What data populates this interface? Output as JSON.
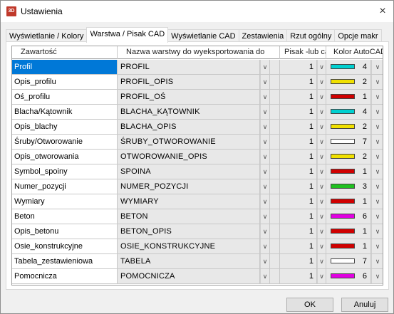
{
  "window": {
    "title": "Ustawienia",
    "app_icon_text": "3D",
    "close_glyph": "×"
  },
  "tabs": [
    {
      "label": "Wyświetlanie / Kolory",
      "active": false
    },
    {
      "label": "Warstwa / Pisak CAD",
      "active": true
    },
    {
      "label": "Wyświetlanie CAD",
      "active": false
    },
    {
      "label": "Zestawienia",
      "active": false
    },
    {
      "label": "Rzut ogólny",
      "active": false
    },
    {
      "label": "Opcje makr",
      "active": false
    }
  ],
  "grid": {
    "headers": {
      "content": "Zawartość",
      "layer": "Nazwa warstwy do wyeksportowania do",
      "pen": "Pisak -lub cad-",
      "color": "Kolor AutoCAD"
    },
    "dropdown_glyph": "∨",
    "rows": [
      {
        "content": "Profil",
        "layer": "PROFIL",
        "pen": "1",
        "color_num": "4",
        "color": "#00d0d0",
        "selected": true
      },
      {
        "content": "Opis_profilu",
        "layer": "PROFIL_OPIS",
        "pen": "1",
        "color_num": "2",
        "color": "#f0e000",
        "selected": false
      },
      {
        "content": "Oś_profilu",
        "layer": "PROFIL_OŚ",
        "pen": "1",
        "color_num": "1",
        "color": "#d00000",
        "selected": false
      },
      {
        "content": "Blacha/Kątownik",
        "layer": "BLACHA_KĄTOWNIK",
        "pen": "1",
        "color_num": "4",
        "color": "#00d0d0",
        "selected": false
      },
      {
        "content": "Opis_blachy",
        "layer": "BLACHA_OPIS",
        "pen": "1",
        "color_num": "2",
        "color": "#f0e000",
        "selected": false
      },
      {
        "content": "Śruby/Otworowanie",
        "layer": "ŚRUBY_OTWOROWANIE",
        "pen": "1",
        "color_num": "7",
        "color": "#ffffff",
        "selected": false
      },
      {
        "content": "Opis_otworowania",
        "layer": "OTWOROWANIE_OPIS",
        "pen": "1",
        "color_num": "2",
        "color": "#f0e000",
        "selected": false
      },
      {
        "content": "Symbol_spoiny",
        "layer": "SPOINA",
        "pen": "1",
        "color_num": "1",
        "color": "#d00000",
        "selected": false
      },
      {
        "content": "Numer_pozycji",
        "layer": "NUMER_POZYCJI",
        "pen": "1",
        "color_num": "3",
        "color": "#20c020",
        "selected": false
      },
      {
        "content": "Wymiary",
        "layer": "WYMIARY",
        "pen": "1",
        "color_num": "1",
        "color": "#d00000",
        "selected": false
      },
      {
        "content": "Beton",
        "layer": "BETON",
        "pen": "1",
        "color_num": "6",
        "color": "#e000e0",
        "selected": false
      },
      {
        "content": "Opis_betonu",
        "layer": "BETON_OPIS",
        "pen": "1",
        "color_num": "1",
        "color": "#d00000",
        "selected": false
      },
      {
        "content": "Osie_konstrukcyjne",
        "layer": "OSIE_KONSTRUKCYJNE",
        "pen": "1",
        "color_num": "1",
        "color": "#d00000",
        "selected": false
      },
      {
        "content": "Tabela_zestawieniowa",
        "layer": "TABELA",
        "pen": "1",
        "color_num": "7",
        "color": "#ffffff",
        "selected": false
      },
      {
        "content": "Pomocnicza",
        "layer": "POMOCNICZA",
        "pen": "1",
        "color_num": "6",
        "color": "#e000e0",
        "selected": false
      }
    ]
  },
  "buttons": {
    "ok": "OK",
    "cancel": "Anuluj"
  }
}
